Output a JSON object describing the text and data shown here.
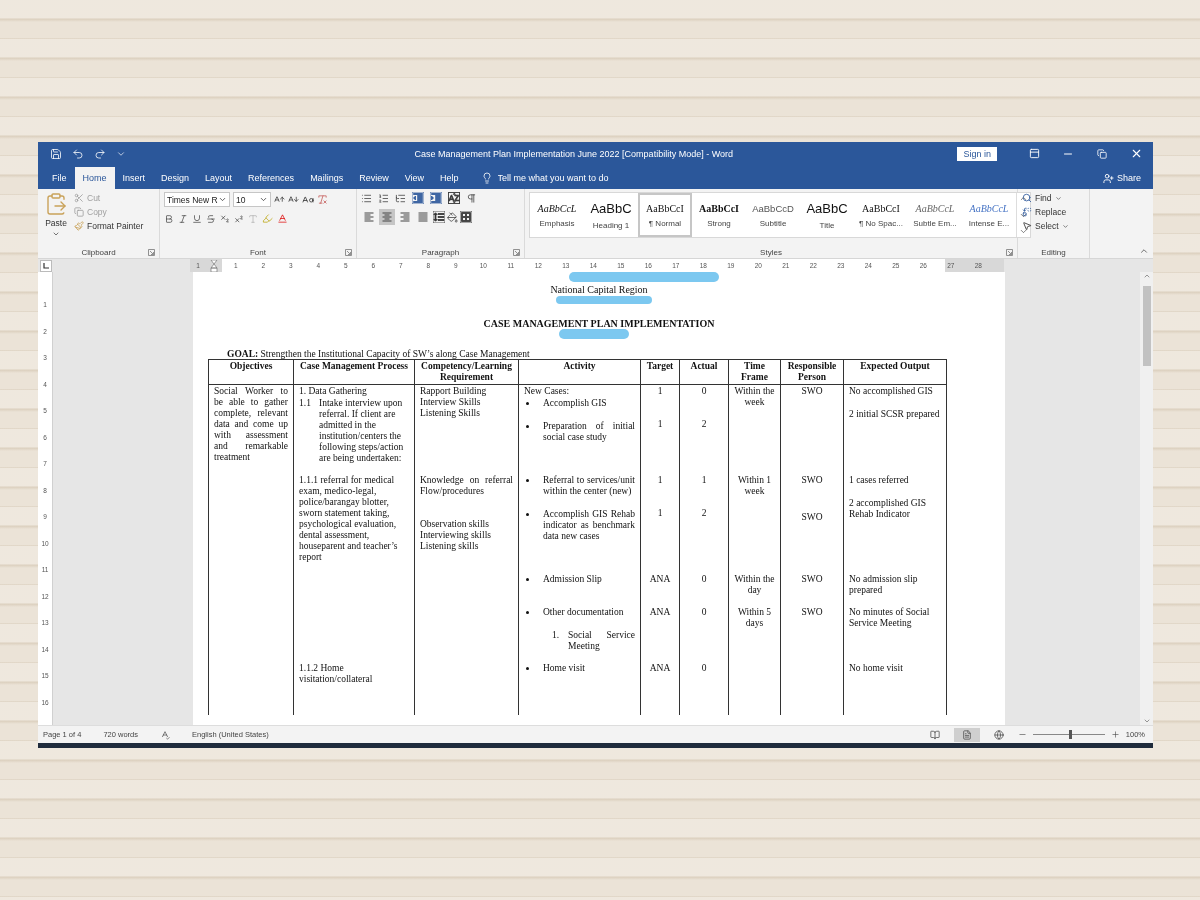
{
  "window": {
    "title": "Case Management Plan Implementation June 2022 [Compatibility Mode]  -  Word",
    "sign_in": "Sign in"
  },
  "menu_tabs": [
    {
      "label": "File",
      "selected": false
    },
    {
      "label": "Home",
      "selected": true
    },
    {
      "label": "Insert",
      "selected": false
    },
    {
      "label": "Design",
      "selected": false
    },
    {
      "label": "Layout",
      "selected": false
    },
    {
      "label": "References",
      "selected": false
    },
    {
      "label": "Mailings",
      "selected": false
    },
    {
      "label": "Review",
      "selected": false
    },
    {
      "label": "View",
      "selected": false
    },
    {
      "label": "Help",
      "selected": false
    }
  ],
  "tell_me": {
    "placeholder": "Tell me what you want to do"
  },
  "share": "Share",
  "ribbon": {
    "clipboard": {
      "label": "Clipboard",
      "paste": "Paste",
      "cut": {
        "label": "Cut",
        "disabled": true
      },
      "copy": {
        "label": "Copy",
        "disabled": true
      },
      "format_painter": {
        "label": "Format Painter",
        "disabled": false
      }
    },
    "font": {
      "label": "Font",
      "font_name": "Times New R",
      "font_size": "10"
    },
    "paragraph": {
      "label": "Paragraph",
      "alignments": [
        {
          "kind": "left",
          "selected": false
        },
        {
          "kind": "center",
          "selected": true
        },
        {
          "kind": "right",
          "selected": false
        },
        {
          "kind": "justify",
          "selected": false
        }
      ]
    },
    "styles": {
      "label": "Styles",
      "items": [
        {
          "kind": "emphasis",
          "preview": "AaBbCcL",
          "name": "Emphasis",
          "selected": false
        },
        {
          "kind": "heading",
          "preview": "AaBbC",
          "name": "Heading 1",
          "selected": false
        },
        {
          "kind": "normal",
          "preview": "AaBbCcI",
          "name": "¶ Normal",
          "selected": true
        },
        {
          "kind": "strong",
          "preview": "AaBbCcI",
          "name": "Strong",
          "selected": false
        },
        {
          "kind": "subtitle",
          "preview": "AaBbCcD",
          "name": "Subtitle",
          "selected": false
        },
        {
          "kind": "title",
          "preview": "AaBbC",
          "name": "Title",
          "selected": false
        },
        {
          "kind": "normal",
          "preview": "AaBbCcI",
          "name": "¶ No Spac...",
          "selected": false
        },
        {
          "kind": "subtle",
          "preview": "AaBbCcL",
          "name": "Subtle Em...",
          "selected": false
        },
        {
          "kind": "intense",
          "preview": "AaBbCcL",
          "name": "Intense E...",
          "selected": false
        }
      ]
    },
    "editing": {
      "label": "Editing",
      "find": "Find",
      "replace": "Replace",
      "select": "Select"
    }
  },
  "ruler": {
    "horizontal": [
      "1",
      "1",
      "2",
      "3",
      "4",
      "5",
      "6",
      "7",
      "8",
      "9",
      "10",
      "11",
      "12",
      "13",
      "14",
      "15",
      "16",
      "17",
      "18",
      "19",
      "20",
      "21",
      "22",
      "23",
      "24",
      "25",
      "26",
      "27",
      "28"
    ],
    "vertical": [
      "1",
      "2",
      "3",
      "4",
      "5",
      "6",
      "7",
      "8",
      "9",
      "10",
      "11",
      "12",
      "13",
      "14",
      "15",
      "16"
    ]
  },
  "document": {
    "region": "National Capital Region",
    "title": "CASE MANAGEMENT PLAN IMPLEMENTATION",
    "goal": "**GOAL:** Strengthen the Institutional Capacity of SW’s along Case Management",
    "table": {
      "columns": [
        "Objectives",
        "Case Management Process",
        "Competency/Learning Requirement",
        "Activity",
        "Target",
        "Actual",
        "Time Frame",
        "Responsible Person",
        "Expected Output"
      ],
      "rows": [
        {
          "cells": [
            {
              "paragraphs": [
                {
                  "kind": "text",
                  "text": "Social Worker to be able to gather complete, relevant data and come up with assessment and remarkable treatment"
                }
              ]
            },
            {
              "paragraphs": [
                {
                  "kind": "text",
                  "text": "1. Data Gathering"
                },
                {
                  "kind": "numbered",
                  "number": "1.1",
                  "text": "Intake interview upon referral. If client are admitted in the institution/centers the following steps/action are being undertaken:"
                }
              ]
            },
            {
              "paragraphs": [
                {
                  "kind": "text",
                  "text": "Rapport Building\nInterview Skills\nListening Skills"
                }
              ]
            },
            {
              "paragraphs": [
                {
                  "kind": "text",
                  "text": "New Cases:"
                },
                {
                  "kind": "bullet",
                  "text": "Accomplish GIS"
                },
                {
                  "kind": "bullet",
                  "text": "Preparation of initial social case study"
                }
              ]
            },
            {
              "paragraphs": [
                {
                  "kind": "text",
                  "text": "1"
                },
                {
                  "kind": "text",
                  "text": "1"
                }
              ]
            },
            {
              "paragraphs": [
                {
                  "kind": "text",
                  "text": "0"
                },
                {
                  "kind": "text",
                  "text": "2"
                }
              ]
            },
            {
              "paragraphs": [
                {
                  "kind": "text",
                  "text": "Within the week"
                }
              ]
            },
            {
              "paragraphs": [
                {
                  "kind": "text",
                  "text": "SWO"
                }
              ]
            },
            {
              "paragraphs": [
                {
                  "kind": "text",
                  "text": "No accomplished GIS"
                },
                {
                  "kind": "text",
                  "text": "2 initial SCSR prepared"
                }
              ]
            }
          ]
        },
        {
          "cells": [
            null,
            {
              "paragraphs": [
                {
                  "kind": "text",
                  "text": "1.1.1 referral for medical exam, medico-legal, police/barangay blotter, sworn statement taking, psychological evaluation, dental assessment, houseparent and teacher’s report"
                }
              ]
            },
            {
              "paragraphs": [
                {
                  "kind": "text",
                  "text": "Knowledge on referral Flow/procedures"
                },
                {
                  "kind": "text",
                  "text": "Observation skills\nInterviewing skills\nListening skills"
                }
              ]
            },
            {
              "paragraphs": [
                {
                  "kind": "bullet",
                  "text": "Referral to services/unit within the center (new)"
                },
                {
                  "kind": "bullet",
                  "text": "Accomplish GIS Rehab indicator as benchmark data new cases"
                }
              ]
            },
            {
              "paragraphs": [
                {
                  "kind": "text",
                  "text": "1"
                },
                {
                  "kind": "text",
                  "text": "1"
                }
              ]
            },
            {
              "paragraphs": [
                {
                  "kind": "text",
                  "text": "1"
                },
                {
                  "kind": "text",
                  "text": "2"
                }
              ]
            },
            {
              "paragraphs": [
                {
                  "kind": "text",
                  "text": "Within 1 week"
                }
              ]
            },
            {
              "paragraphs": [
                {
                  "kind": "text",
                  "text": "SWO"
                },
                {
                  "kind": "text",
                  "text": "SWO"
                }
              ]
            },
            {
              "paragraphs": [
                {
                  "kind": "text",
                  "text": "1 cases referred"
                },
                {
                  "kind": "text",
                  "text": "2 accomplished GIS Rehab Indicator"
                }
              ]
            }
          ]
        },
        {
          "cells": [
            null,
            null,
            null,
            {
              "paragraphs": [
                {
                  "kind": "bullet",
                  "text": "Admission Slip"
                }
              ]
            },
            {
              "paragraphs": [
                {
                  "kind": "text",
                  "text": "ANA"
                }
              ]
            },
            {
              "paragraphs": [
                {
                  "kind": "text",
                  "text": "0"
                }
              ]
            },
            {
              "paragraphs": [
                {
                  "kind": "text",
                  "text": "Within the day"
                }
              ]
            },
            {
              "paragraphs": [
                {
                  "kind": "text",
                  "text": "SWO"
                }
              ]
            },
            {
              "paragraphs": [
                {
                  "kind": "text",
                  "text": "No admission slip prepared"
                }
              ]
            }
          ]
        },
        {
          "cells": [
            null,
            null,
            null,
            {
              "paragraphs": [
                {
                  "kind": "bullet",
                  "text": "Other documentation"
                },
                {
                  "kind": "numbered",
                  "number": "1.",
                  "text": "Social Service Meeting"
                }
              ]
            },
            {
              "paragraphs": [
                {
                  "kind": "text",
                  "text": "ANA"
                }
              ]
            },
            {
              "paragraphs": [
                {
                  "kind": "text",
                  "text": "0"
                }
              ]
            },
            {
              "paragraphs": [
                {
                  "kind": "text",
                  "text": "Within 5 days"
                }
              ]
            },
            {
              "paragraphs": [
                {
                  "kind": "text",
                  "text": "SWO"
                }
              ]
            },
            {
              "paragraphs": [
                {
                  "kind": "text",
                  "text": "No minutes of Social Service Meeting"
                }
              ]
            }
          ]
        },
        {
          "cells": [
            null,
            {
              "paragraphs": [
                {
                  "kind": "text",
                  "text": "1.1.2 Home visitation/collateral"
                }
              ]
            },
            null,
            {
              "paragraphs": [
                {
                  "kind": "bullet",
                  "text": "Home visit"
                }
              ]
            },
            {
              "paragraphs": [
                {
                  "kind": "text",
                  "text": "ANA"
                }
              ]
            },
            {
              "paragraphs": [
                {
                  "kind": "text",
                  "text": "0"
                }
              ]
            },
            null,
            null,
            {
              "paragraphs": [
                {
                  "kind": "text",
                  "text": "No home visit"
                }
              ]
            }
          ]
        }
      ]
    }
  },
  "status_bar": {
    "page": "Page 1 of 4",
    "words": "720 words",
    "language": "English (United States)",
    "views": [
      {
        "kind": "read",
        "selected": false
      },
      {
        "kind": "print",
        "selected": true
      },
      {
        "kind": "web",
        "selected": false
      }
    ],
    "zoom": {
      "level": 0.5,
      "reading": "100%"
    }
  }
}
